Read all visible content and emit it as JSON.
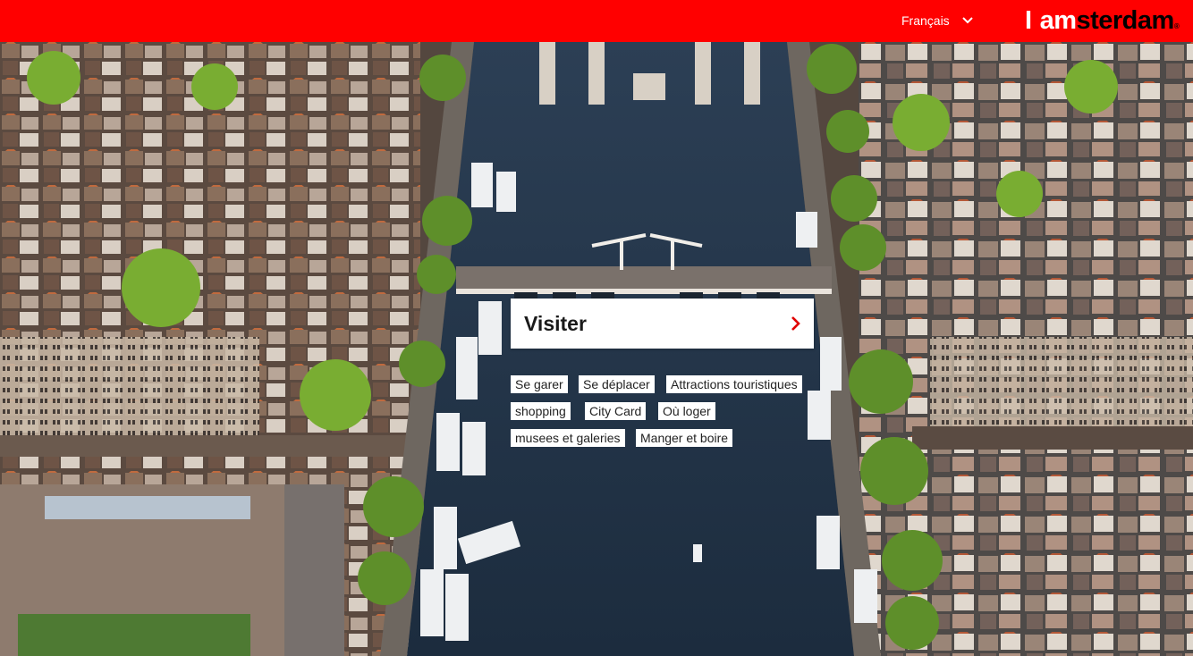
{
  "header": {
    "language_label": "Français",
    "logo": {
      "prefix": "I",
      "word_red": "am",
      "word_black": "sterdam",
      "registered": "®"
    }
  },
  "hero": {
    "image": "aerial-amsterdam-canal",
    "colors": {
      "brand_red": "#ff0000",
      "water": "#22344a"
    }
  },
  "card": {
    "title": "Visiter",
    "icon": "chevron-right-icon"
  },
  "tags": [
    "Se garer",
    "Se déplacer",
    "Attractions touristiques",
    "shopping",
    "City Card",
    "Où loger",
    "musees et galeries",
    "Manger et boire"
  ]
}
